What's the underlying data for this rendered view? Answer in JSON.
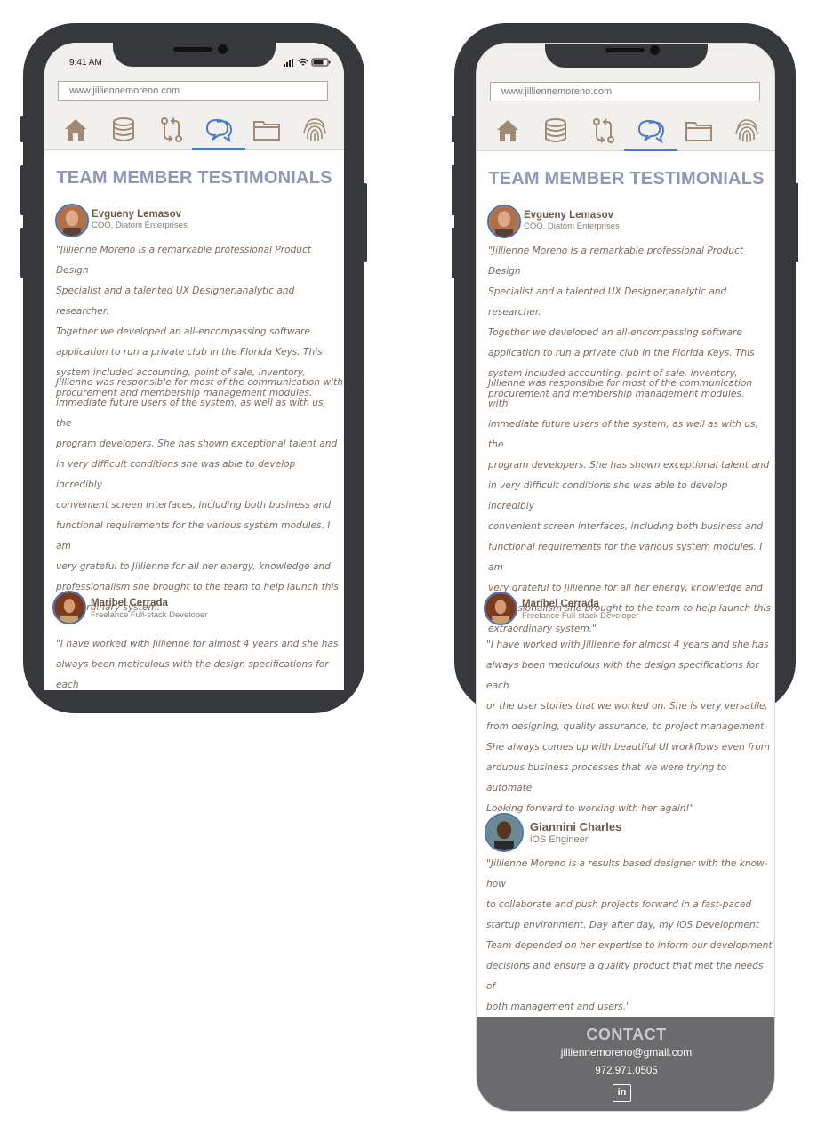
{
  "status": {
    "time": "9:41 AM"
  },
  "browser": {
    "url": "www.jilliennemoreno.com"
  },
  "nav": {
    "tabs": [
      "home-icon",
      "database-icon",
      "git-compare-icon",
      "chat-bubbles-icon",
      "folder-icon",
      "fingerprint-icon"
    ],
    "active_index": 3
  },
  "page": {
    "title": "TEAM MEMBER TESTIMONIALS"
  },
  "testimonials": [
    {
      "name": "Evgueny Lemasov",
      "role": "COO, Diatom Enterprises",
      "paragraph1": "\"Jillienne Moreno is a remarkable professional Product Design\nSpecialist and a talented UX Designer,analytic and researcher.\nTogether we developed an all-encompassing software\napplication to run a private club in the Florida Keys. This\nsystem included accounting, point of sale, inventory,\nprocurement and membership management modules.",
      "paragraph2": "Jillienne was responsible for most of the communication with\nimmediate future users of the system, as well as with us, the\nprogram developers. She has shown exceptional talent and\nin very difficult conditions she was able to develop incredibly\nconvenient screen interfaces, including both business and\nfunctional requirements for the various system modules. I am\nvery grateful to Jillienne for all her energy, knowledge and\nprofessionalism she brought to the team to help launch this\nextraordinary system.\""
    },
    {
      "name": "Maribel Cerrada",
      "role": "Freelance Full-stack Developer",
      "paragraph1_short": "\"I have worked with Jillienne for almost 4 years and she has\nalways been meticulous with the design specifications for each\nor the user stories that we worked on. She is very versatile,",
      "paragraph1": "\"I have worked with Jillienne for almost 4 years and she has\nalways been meticulous with the design specifications for each\nor the user stories that we worked on. She is very versatile,\nfrom designing, quality assurance, to project management.\nShe always comes up with beautiful UI workflows even from\narduous business processes that we were trying to automate.\nLooking forward to working with her again!\""
    },
    {
      "name": "Giannini Charles",
      "role": "iOS Engineer",
      "paragraph1": "\"Jillienne Moreno is a results based designer with the know-how\nto collaborate and push projects forward in a fast-paced\nstartup environment. Day after day, my iOS Development\nTeam depended on her expertise to inform our development\ndecisions and ensure a quality product that met the needs of\nboth management and users.\""
    }
  ],
  "contact": {
    "title": "CONTACT",
    "email": "jilliennemoreno@gmail.com",
    "phone": "972.971.0505",
    "linkedin_label": "in"
  },
  "colors": {
    "frame": "#37383b",
    "title": "#8f97b9",
    "accent": "#4b7bc6",
    "icon": "#a08a76",
    "contact_bg": "#6b6b6d"
  }
}
